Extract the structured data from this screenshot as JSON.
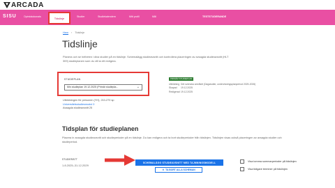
{
  "brand": {
    "logo_text": "ARCADA"
  },
  "nav": {
    "app_name": "SISU",
    "links": [
      "Opintokokonais",
      "Tidslinje",
      "Studier",
      "Studiekalendern",
      "Mitt profil",
      "Mål"
    ],
    "user": "TESTSTUDERANDE"
  },
  "breadcrumb": {
    "home": "Hem",
    "separator": "›",
    "current": "Tidslinje"
  },
  "page": {
    "title": "Tidslinje",
    "intro": "Planera och se helheten i dina studier på en tidslinje. Schemalägg studieavsnitt och kontrollera placeringen av avsagda studieavsnitt (HLT 309) studieplanen som du vill ta ett redigera."
  },
  "study_plan": {
    "label": "STUDIEPLAN",
    "selected": "Min studieplan 19.12.2025 (Primär studiepla...",
    "info_line1": "Utbildningen för personen (YH), 210-270 sp",
    "info_line2": "Universitetsstudiesmodul 0",
    "info_line3": "Avsagda studieavsnitt 25"
  },
  "status": {
    "badge": "PRIMÄR STUDIEPLAN",
    "meta": [
      {
        "key": "Utbildning",
        "value": "Det svenska området (Dagstudier, undervisningsplanperiod 2025-2026)"
      },
      {
        "key": "Skapad",
        "value": "19.12.2025"
      },
      {
        "key": "Redigerad",
        "value": "19.12.2025"
      }
    ]
  },
  "schedule": {
    "title": "Tidsplan för studieplanen",
    "intro": "Placera in avsagda studieavsnitt och studieperioder på en tidslinje. Du kan redigera och ta bort studieperioder från tidslinjen. Tidslinjen visas också placeringen av avsagda studier och studieperiod.",
    "studies_label": "STUDIERÄTT",
    "studies_dates": "1.8.2025–31.12.2029",
    "schedule_button": "SCHEMALÄGG STUDIEAVSNITT MED TAJMNINGSMODELL",
    "remove_button": "TA BORT ALLA SCHEMAN",
    "checkbox1": "Visa tomma sommarperioder på tidslinjen",
    "checkbox2": "Visa tidigare terminer på tidslinjen"
  },
  "colors": {
    "nav_bg": "#e94fa3",
    "highlight": "#e53935",
    "primary": "#1a73e8",
    "success": "#2e7d32"
  }
}
